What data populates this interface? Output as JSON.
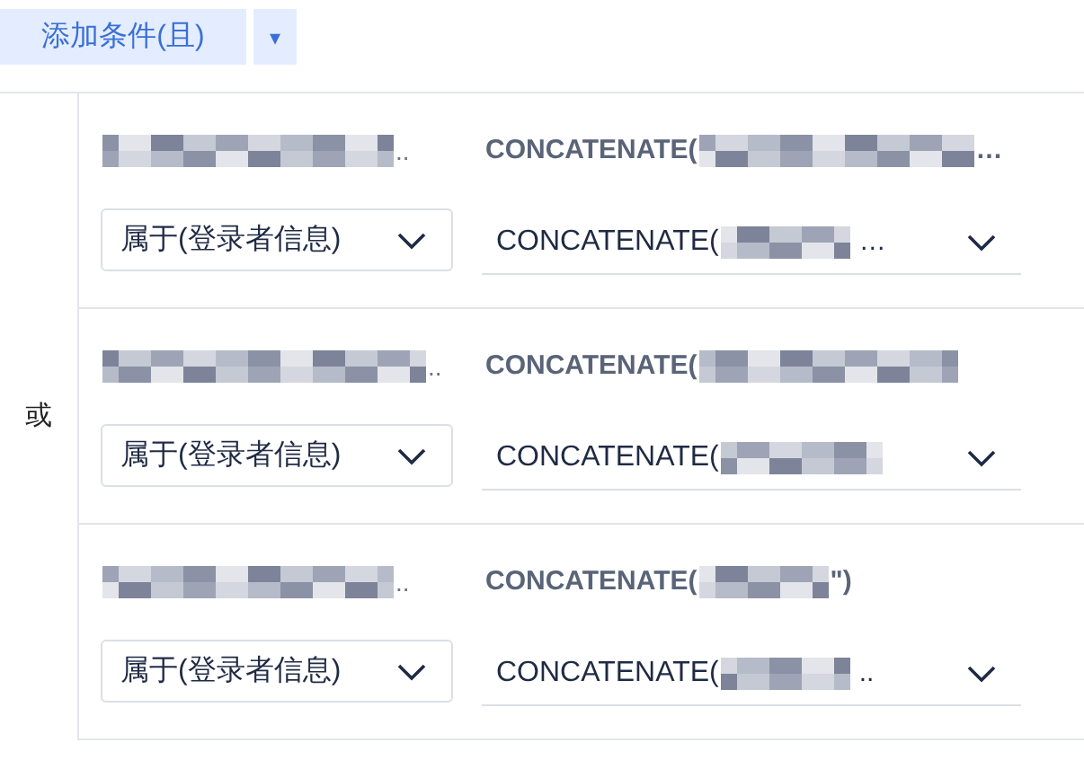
{
  "toolbar": {
    "add_button": "添加条件(且)",
    "dropdown_arrow": "▾"
  },
  "group": {
    "operator": "或",
    "conditions": [
      {
        "name_end": "..",
        "formula": "CONCATENATE(",
        "formula_end": "…",
        "operator": "属于(登录者信息)",
        "value": "CONCATENATE(",
        "value_end": "…"
      },
      {
        "name_end": "..",
        "formula": "CONCATENATE(",
        "operator": "属于(登录者信息)",
        "value": "CONCATENATE("
      },
      {
        "name_end": "..",
        "formula": "CONCATENATE(",
        "formula_end": "\")",
        "operator": "属于(登录者信息)",
        "value": "CONCATENATE(",
        "value_end": ".."
      }
    ]
  }
}
